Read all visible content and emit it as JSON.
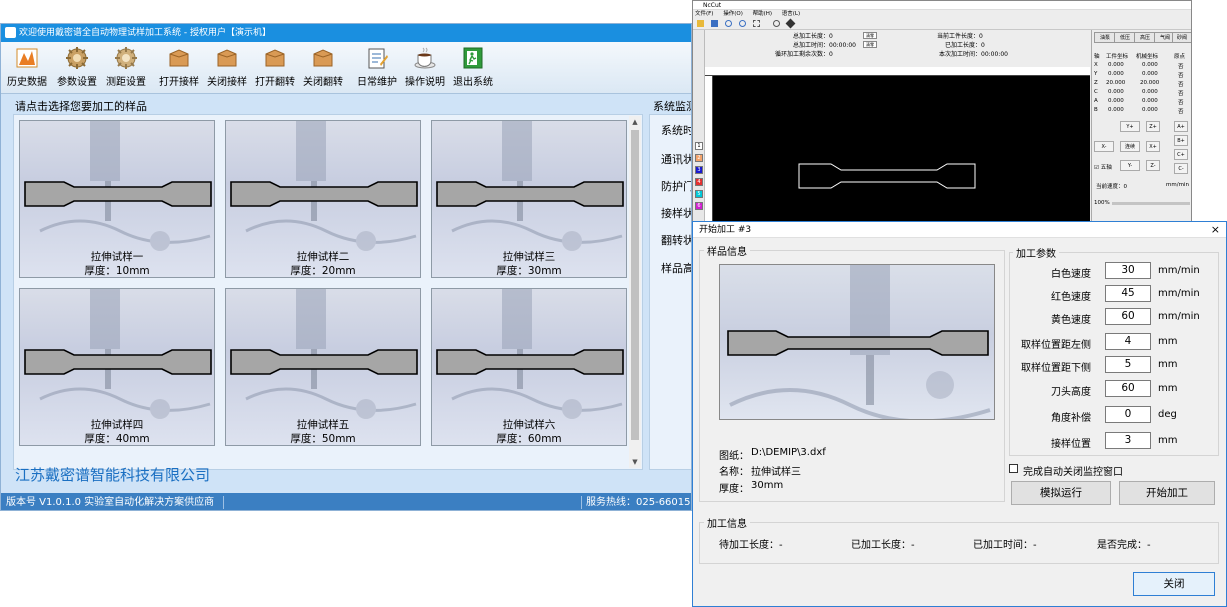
{
  "main": {
    "title": "欢迎使用戴密谱全自动物理试样加工系统 - 授权用户【演示机】",
    "toolbar": [
      {
        "label": "历史数据",
        "icon": "chart-icon"
      },
      {
        "label": "参数设置",
        "icon": "gear-icon"
      },
      {
        "label": "测距设置",
        "icon": "gear-icon"
      },
      {
        "label": "打开接样",
        "icon": "box-icon"
      },
      {
        "label": "关闭接样",
        "icon": "box-icon"
      },
      {
        "label": "打开翻转",
        "icon": "box-icon"
      },
      {
        "label": "关闭翻转",
        "icon": "box-icon"
      },
      {
        "label": "日常维护",
        "icon": "notepad-icon"
      },
      {
        "label": "操作说明",
        "icon": "coffee-icon"
      },
      {
        "label": "退出系统",
        "icon": "exit-icon"
      }
    ],
    "sample_heading": "请点击选择您要加工的样品",
    "samples": [
      {
        "name": "拉伸试样一",
        "thickness": "厚度：10mm"
      },
      {
        "name": "拉伸试样二",
        "thickness": "厚度：20mm"
      },
      {
        "name": "拉伸试样三",
        "thickness": "厚度：30mm"
      },
      {
        "name": "拉伸试样四",
        "thickness": "厚度：40mm"
      },
      {
        "name": "拉伸试样五",
        "thickness": "厚度：50mm"
      },
      {
        "name": "拉伸试样六",
        "thickness": "厚度：60mm"
      }
    ],
    "monitor_title": "系统监测",
    "monitor_items": [
      "系统时",
      "通讯状",
      "防护门",
      "接样状",
      "翻转状",
      "样品高"
    ],
    "company": "江苏戴密谱智能科技有限公司",
    "version": "版本号 V1.0.1.0 实验室自动化解决方案供应商",
    "hotline": "服务热线：025-66015"
  },
  "cnc": {
    "title": "NcCut",
    "menu": [
      "文件(F)",
      "操作(O)",
      "帮助(H)",
      "语言(L)"
    ],
    "info": {
      "total_len_label": "总加工长度：0",
      "total_time_label": "总加工时间：00:00:00",
      "loop_label": "循环加工剩余次数：0",
      "cur_len_label": "当前工件长度：0",
      "done_len_label": "已加工长度：0",
      "this_time_label": "本次加工时间：00:00:00",
      "clear": "清零"
    },
    "tabs": [
      "油泵",
      "低压",
      "高压",
      "气阀",
      "砂阀"
    ],
    "axis_headers": [
      "轴",
      "工件坐标",
      "机械坐标",
      "原点"
    ],
    "axes": [
      {
        "axis": "X",
        "work": "0.000",
        "mach": "0.000",
        "origin": "否"
      },
      {
        "axis": "Y",
        "work": "0.000",
        "mach": "0.000",
        "origin": "否"
      },
      {
        "axis": "Z",
        "work": "20.000",
        "mach": "20.000",
        "origin": "否"
      },
      {
        "axis": "C",
        "work": "0.000",
        "mach": "0.000",
        "origin": "否"
      },
      {
        "axis": "A",
        "work": "0.000",
        "mach": "0.000",
        "origin": "否"
      },
      {
        "axis": "B",
        "work": "0.000",
        "mach": "0.000",
        "origin": "否"
      }
    ],
    "jog": {
      "y_plus": "Y+",
      "z_plus": "Z+",
      "a_plus": "A+",
      "b_plus": "B+",
      "x_minus": "X-",
      "cont": "连续",
      "x_plus": "X+",
      "c_plus": "C+",
      "c_minus": "C-",
      "y_minus": "Y-",
      "z_minus": "Z-",
      "step": "五轴"
    },
    "speed_label": "当前速度：0",
    "speed_unit": "mm/min",
    "percent": "100%"
  },
  "dialog": {
    "title": "开始加工 #3",
    "close": "×",
    "sample_group": "样品信息",
    "drawing_label": "图纸：",
    "drawing_value": "D:\\DEMIP\\3.dxf",
    "name_label": "名称：",
    "name_value": "拉伸试样三",
    "thick_label": "厚度：",
    "thick_value": "30mm",
    "param_group": "加工参数",
    "params": [
      {
        "label": "白色速度",
        "value": "30",
        "unit": "mm/min"
      },
      {
        "label": "红色速度",
        "value": "45",
        "unit": "mm/min"
      },
      {
        "label": "黄色速度",
        "value": "60",
        "unit": "mm/min"
      },
      {
        "label": "取样位置距左侧",
        "value": "4",
        "unit": "mm"
      },
      {
        "label": "取样位置距下侧",
        "value": "5",
        "unit": "mm"
      },
      {
        "label": "刀头高度",
        "value": "60",
        "unit": "mm"
      },
      {
        "label": "角度补偿",
        "value": "0",
        "unit": "deg"
      },
      {
        "label": "接样位置",
        "value": "3",
        "unit": "mm"
      }
    ],
    "auto_close_label": "完成自动关闭监控窗口",
    "simulate_button": "模拟运行",
    "start_button": "开始加工",
    "progress_group": "加工信息",
    "progress": {
      "pending_len": "待加工长度：-",
      "done_len": "已加工长度：-",
      "done_time": "已加工时间：-",
      "finished": "是否完成：-"
    },
    "close_button": "关闭"
  },
  "colors": {
    "title_blue": "#1a8fe0",
    "status_blue": "#3b7fc2",
    "company_blue": "#1a6fc2",
    "specimen_fill": "#a6a6a6"
  }
}
